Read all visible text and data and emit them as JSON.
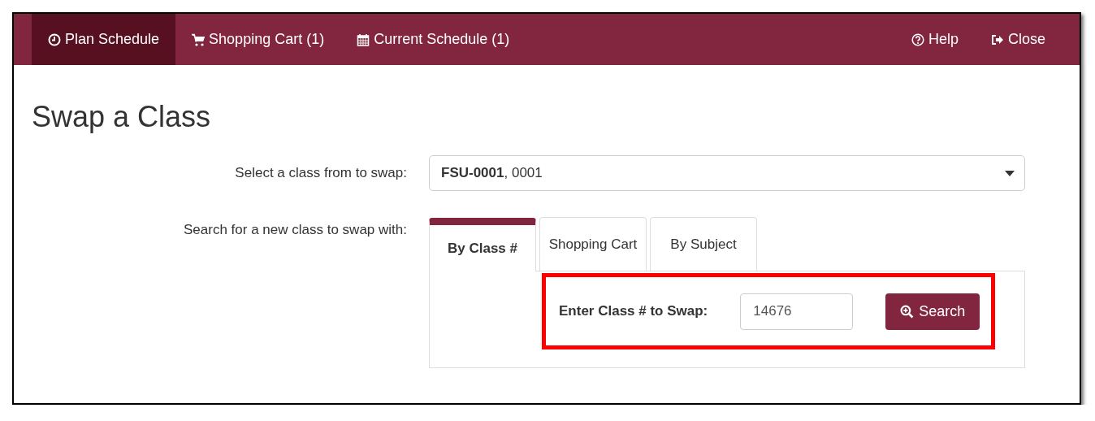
{
  "navbar": {
    "items": [
      {
        "label": "Plan Schedule",
        "selected": true
      },
      {
        "label": "Shopping Cart (1)",
        "selected": false
      },
      {
        "label": "Current Schedule (1)",
        "selected": false
      }
    ],
    "right_items": [
      {
        "label": "Help"
      },
      {
        "label": "Close"
      }
    ]
  },
  "heading": "Swap a Class",
  "select_class": {
    "label": "Select a class from to swap:",
    "value": "**FSU-0001**, 0001"
  },
  "search": {
    "label": "Search for a new class to swap with:",
    "tabs": [
      {
        "label": "By Class #",
        "selected": true
      },
      {
        "label": "Shopping Cart",
        "selected": false
      },
      {
        "label": "By Subject",
        "selected": false
      }
    ],
    "field_label": "Enter Class # to Swap:",
    "field_value": "14676",
    "button": "Search",
    "highlighted": true
  }
}
